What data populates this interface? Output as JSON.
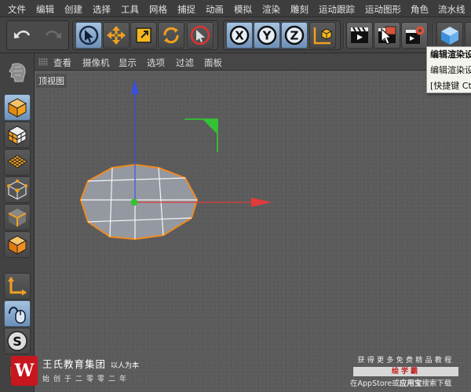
{
  "menu": [
    "文件",
    "编辑",
    "创建",
    "选择",
    "工具",
    "网格",
    "捕捉",
    "动画",
    "模拟",
    "渲染",
    "雕刻",
    "运动跟踪",
    "运动图形",
    "角色",
    "流水线"
  ],
  "viewport_menu": [
    "查看",
    "摄像机",
    "显示",
    "选项",
    "过滤",
    "面板"
  ],
  "viewport_label": "顶视图",
  "tooltip": [
    "编辑渲染设",
    "编辑渲染设",
    "[快捷键 Ct"
  ],
  "axis_buttons": [
    "X",
    "Y",
    "Z"
  ],
  "left_tool_badge": "S",
  "watermark_left": {
    "logo": "W",
    "brand": "王氏教育集团",
    "slogan": "以人为本",
    "founded": "始创于二零零二年"
  },
  "watermark_right": {
    "line1": "获得更多免费精品教程",
    "line2": "绘学霸",
    "line3_a": "在",
    "line3_b": "AppStore",
    "line3_c": "或",
    "line3_d": "应用宝",
    "line3_e": "搜索下载"
  },
  "colors": {
    "axis_x": "#e23b3b",
    "axis_y": "#33c233",
    "axis_z": "#3a4fe0",
    "selection_outline": "#f08a22",
    "mesh_fill": "#9aa0a8",
    "render_red": "#d8533a"
  }
}
